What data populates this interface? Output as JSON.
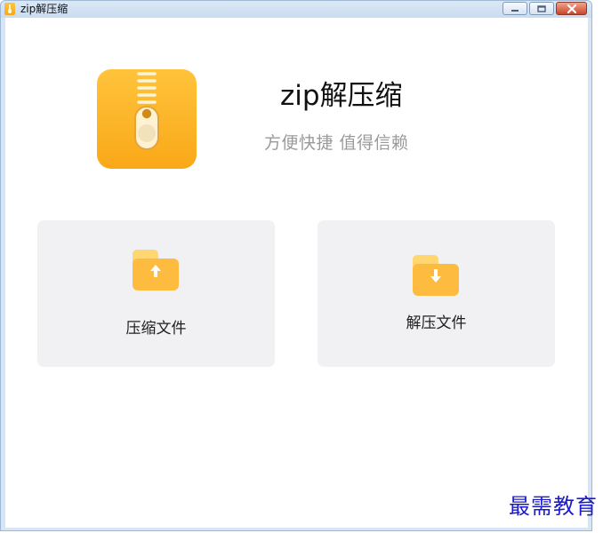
{
  "window": {
    "title": "zip解压缩",
    "controls": {
      "minimize": "minimize-icon",
      "maximize": "maximize-icon",
      "close": "close-icon"
    }
  },
  "header": {
    "app_name": "zip解压缩",
    "tagline": "方便快捷 值得信赖",
    "logo_icon": "zip-file-icon"
  },
  "actions": [
    {
      "label": "压缩文件",
      "icon": "folder-upload-icon"
    },
    {
      "label": "解压文件",
      "icon": "folder-download-icon"
    }
  ],
  "watermark": {
    "text": "最需教育"
  },
  "colors": {
    "accent": "#FDB52A",
    "card_background": "#F1F1F4",
    "title_text": "#111111",
    "subtitle_text": "#9A9A9A",
    "watermark_text": "#1C1AC9"
  }
}
